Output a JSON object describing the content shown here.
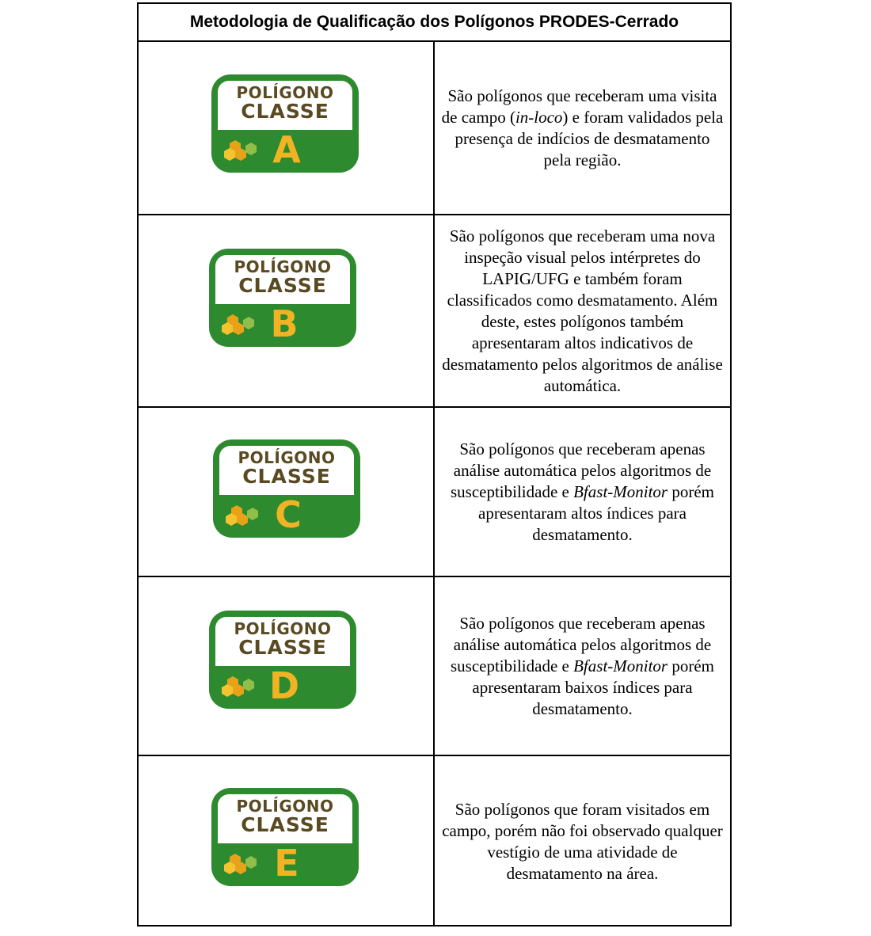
{
  "title": "Metodologia de Qualificação dos Polígonos PRODES-Cerrado",
  "colors": {
    "badge_green": "#2e8a2e",
    "badge_text_brown": "#5a4a22",
    "letter_yellow": "#f0b323",
    "hex_orange": "#e8a21a",
    "hex_light_green": "#8fbf4a"
  },
  "badge": {
    "line1": "POLÍGONO",
    "line2": "CLASSE"
  },
  "rows": [
    {
      "letter": "A",
      "desc_before": "São polígonos que receberam uma visita de campo (",
      "desc_italic": "in-loco",
      "desc_after": ") e foram validados pela presença de indícios de desmatamento pela região."
    },
    {
      "letter": "B",
      "desc_before": "São polígonos que receberam uma nova inspeção visual pelos intérpretes do LAPIG/UFG e também foram classificados como desmatamento. Além deste, estes polígonos também apresentaram altos indicativos de desmatamento pelos algoritmos de análise automática.",
      "desc_italic": "",
      "desc_after": ""
    },
    {
      "letter": "C",
      "desc_before": "São polígonos que receberam apenas análise automática pelos algoritmos de susceptibilidade e ",
      "desc_italic": "Bfast-Monitor",
      "desc_after": " porém apresentaram altos índices para desmatamento."
    },
    {
      "letter": "D",
      "desc_before": "São polígonos que receberam apenas análise automática pelos algoritmos de susceptibilidade e ",
      "desc_italic": "Bfast-Monitor",
      "desc_after": " porém apresentaram baixos índices para desmatamento."
    },
    {
      "letter": "E",
      "desc_before": "São polígonos que foram visitados em campo, porém não foi observado qualquer vestígio de uma atividade de desmatamento na área.",
      "desc_italic": "",
      "desc_after": ""
    }
  ]
}
